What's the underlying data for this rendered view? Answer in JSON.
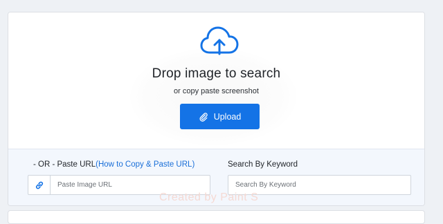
{
  "drop_zone": {
    "icon": "cloud-upload-icon",
    "title": "Drop image to search",
    "subtitle": "or copy paste screenshot",
    "upload_label": "Upload",
    "upload_icon": "paperclip-icon"
  },
  "url_section": {
    "label_prefix": "- OR - Paste URL",
    "help_link": "(How to Copy & Paste URL)",
    "link_icon": "link-icon",
    "placeholder": "Paste Image URL"
  },
  "keyword_section": {
    "label": "Search By Keyword",
    "placeholder": "Search By Keyword"
  },
  "watermark_text": "Created by Paint S",
  "colors": {
    "accent": "#1473e6",
    "link": "#1a6fd8",
    "bottom_bg": "#f3f7fd"
  }
}
